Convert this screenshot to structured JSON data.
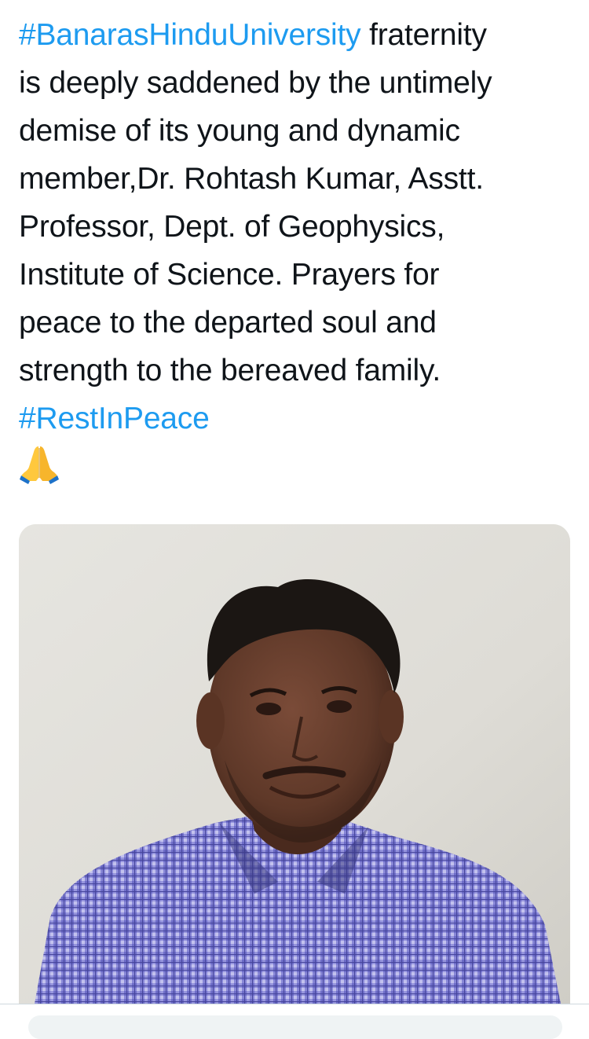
{
  "tweet": {
    "lines": [
      [
        {
          "text": "#BanarasHinduUniversity",
          "hashtag": true
        },
        {
          "text": " fraternity",
          "hashtag": false
        }
      ],
      [
        {
          "text": "is deeply saddened by the untimely",
          "hashtag": false
        }
      ],
      [
        {
          "text": "demise of its young and dynamic",
          "hashtag": false
        }
      ],
      [
        {
          "text": "member,Dr. Rohtash Kumar, Asstt.",
          "hashtag": false
        }
      ],
      [
        {
          "text": "Professor, Dept. of Geophysics,",
          "hashtag": false
        }
      ],
      [
        {
          "text": "Institute of Science. Prayers for",
          "hashtag": false
        }
      ],
      [
        {
          "text": "peace to the departed soul and",
          "hashtag": false
        }
      ],
      [
        {
          "text": "strength to the bereaved family.",
          "hashtag": false
        }
      ],
      [
        {
          "text": "#RestInPeace",
          "hashtag": true
        }
      ]
    ],
    "emoji": "folded-hands-icon"
  },
  "media": {
    "type": "photo",
    "subject": "portrait-photo"
  },
  "colors": {
    "text": "#0f1419",
    "link": "#1d9bf0",
    "background": "#ffffff"
  }
}
